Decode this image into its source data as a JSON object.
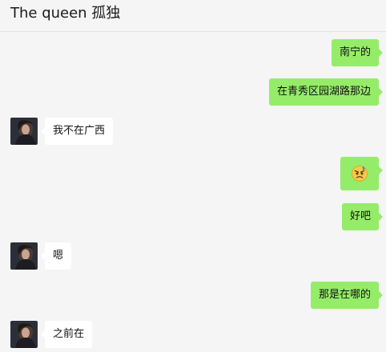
{
  "header": {
    "title": "The queen 孤独"
  },
  "messages": [
    {
      "side": "self",
      "type": "text",
      "text": "南宁的"
    },
    {
      "side": "self",
      "type": "text",
      "text": "在青秀区园湖路那边"
    },
    {
      "side": "other",
      "type": "text",
      "text": "我不在广西"
    },
    {
      "side": "self",
      "type": "emoji",
      "emoji": "angry-face-emoji"
    },
    {
      "side": "self",
      "type": "text",
      "text": "好吧"
    },
    {
      "side": "other",
      "type": "text",
      "text": "嗯"
    },
    {
      "side": "self",
      "type": "text",
      "text": "那是在哪的"
    },
    {
      "side": "other",
      "type": "text",
      "text": "之前在"
    }
  ],
  "colors": {
    "self_bubble": "#95ec69",
    "other_bubble": "#ffffff",
    "background": "#f5f5f5"
  },
  "icons": {
    "avatar": "contact-avatar",
    "emoji": "angry-face-emoji"
  }
}
